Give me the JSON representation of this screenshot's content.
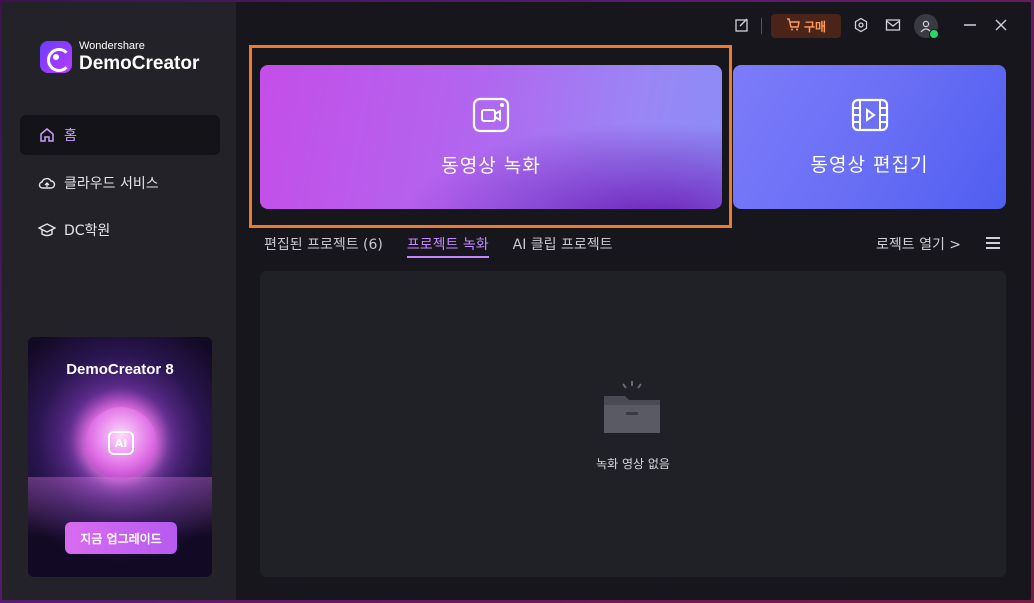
{
  "app": {
    "brand_small": "Wondershare",
    "brand_big": "DemoCreator"
  },
  "sidebar": {
    "items": [
      {
        "label": "홈",
        "icon": "home-icon",
        "active": true
      },
      {
        "label": "클라우드 서비스",
        "icon": "cloud-icon",
        "active": false
      },
      {
        "label": "DC학원",
        "icon": "graduation-cap-icon",
        "active": false
      }
    ],
    "promo": {
      "title": "DemoCreator 8",
      "badge": "AI",
      "button": "지금 업그레이드"
    }
  },
  "titlebar": {
    "buy_label": "구매"
  },
  "cards": {
    "record_label": "동영상 녹화",
    "edit_label": "동영상 편집기"
  },
  "tabs": [
    {
      "label": "편집된 프로젝트 (6)",
      "active": false
    },
    {
      "label": "프로젝트 녹화",
      "active": true
    },
    {
      "label": "AI 클립 프로젝트",
      "active": false
    }
  ],
  "open_project_label": "로젝트 열기 >",
  "empty_state": {
    "text": "녹화 영상 없음"
  },
  "colors": {
    "accent": "#c585ff",
    "highlight": "#f07a2a",
    "buy_text": "#ff9a5a"
  }
}
